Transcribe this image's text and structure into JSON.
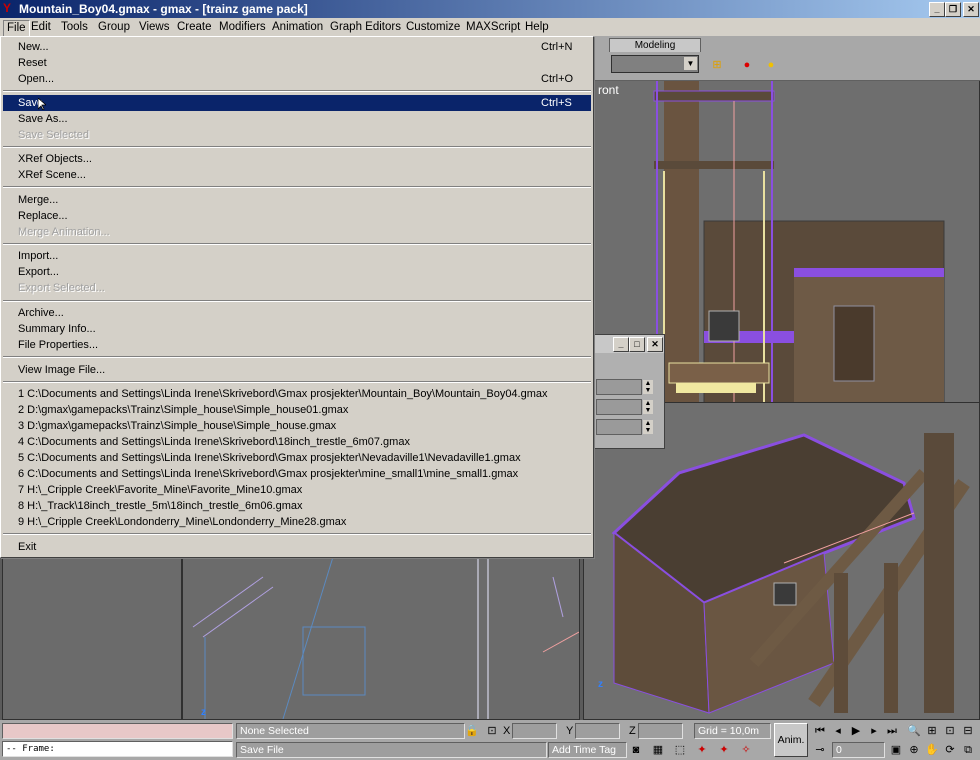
{
  "window": {
    "title": "Mountain_Boy04.gmax - gmax - [trainz game pack]",
    "app_icon": "gmax-logo-icon",
    "controls": [
      "_",
      "❐",
      "✕"
    ]
  },
  "menubar": {
    "items": [
      "File",
      "Edit",
      "Tools",
      "Group",
      "Views",
      "Create",
      "Modifiers",
      "Animation",
      "Graph Editors",
      "Customize",
      "MAXScript",
      "Help"
    ],
    "open_item": "File"
  },
  "file_menu": {
    "items": [
      {
        "label": "New...",
        "shortcut": "Ctrl+N",
        "state": "normal"
      },
      {
        "label": "Reset",
        "shortcut": "",
        "state": "normal"
      },
      {
        "label": "Open...",
        "shortcut": "Ctrl+O",
        "state": "normal"
      },
      {
        "label": "Save",
        "shortcut": "Ctrl+S",
        "state": "highlighted"
      },
      {
        "label": "Save As...",
        "shortcut": "",
        "state": "normal"
      },
      {
        "label": "Save Selected",
        "shortcut": "",
        "state": "disabled"
      },
      {
        "label": "XRef Objects...",
        "shortcut": "",
        "state": "normal"
      },
      {
        "label": "XRef Scene...",
        "shortcut": "",
        "state": "normal"
      },
      {
        "label": "Merge...",
        "shortcut": "",
        "state": "normal"
      },
      {
        "label": "Replace...",
        "shortcut": "",
        "state": "normal"
      },
      {
        "label": "Merge Animation...",
        "shortcut": "",
        "state": "disabled"
      },
      {
        "label": "Import...",
        "shortcut": "",
        "state": "normal"
      },
      {
        "label": "Export...",
        "shortcut": "",
        "state": "normal"
      },
      {
        "label": "Export Selected...",
        "shortcut": "",
        "state": "disabled"
      },
      {
        "label": "Archive...",
        "shortcut": "",
        "state": "normal"
      },
      {
        "label": "Summary Info...",
        "shortcut": "",
        "state": "normal"
      },
      {
        "label": "File Properties...",
        "shortcut": "",
        "state": "normal"
      },
      {
        "label": "View Image File...",
        "shortcut": "",
        "state": "normal"
      },
      {
        "label": "1 C:\\Documents and Settings\\Linda Irene\\Skrivebord\\Gmax prosjekter\\Mountain_Boy\\Mountain_Boy04.gmax",
        "shortcut": "",
        "state": "normal"
      },
      {
        "label": "2 D:\\gmax\\gamepacks\\Trainz\\Simple_house\\Simple_house01.gmax",
        "shortcut": "",
        "state": "normal"
      },
      {
        "label": "3 D:\\gmax\\gamepacks\\Trainz\\Simple_house\\Simple_house.gmax",
        "shortcut": "",
        "state": "normal"
      },
      {
        "label": "4 C:\\Documents and Settings\\Linda Irene\\Skrivebord\\18inch_trestle_6m07.gmax",
        "shortcut": "",
        "state": "normal"
      },
      {
        "label": "5 C:\\Documents and Settings\\Linda Irene\\Skrivebord\\Gmax prosjekter\\Nevadaville1\\Nevadaville1.gmax",
        "shortcut": "",
        "state": "normal"
      },
      {
        "label": "6 C:\\Documents and Settings\\Linda Irene\\Skrivebord\\Gmax prosjekter\\mine_small1\\mine_small1.gmax",
        "shortcut": "",
        "state": "normal"
      },
      {
        "label": "7 H:\\_Cripple Creek\\Favorite_Mine\\Favorite_Mine10.gmax",
        "shortcut": "",
        "state": "normal"
      },
      {
        "label": "8 H:\\_Track\\18inch_trestle_5m\\18inch_trestle_6m06.gmax",
        "shortcut": "",
        "state": "normal"
      },
      {
        "label": "9 H:\\_Cripple Creek\\Londonderry_Mine\\Londonderry_Mine28.gmax",
        "shortcut": "",
        "state": "normal"
      },
      {
        "label": "Exit",
        "shortcut": "",
        "state": "normal"
      }
    ]
  },
  "viewports": {
    "front_label": "ront",
    "tab_label": "Modeling"
  },
  "statusbar": {
    "maxscript_listener": "",
    "maxscript_output": "-- Frame:",
    "selection": "None Selected",
    "prompt": "Save File",
    "x_label": "X",
    "y_label": "Y",
    "z_label": "Z",
    "x_value": "",
    "y_value": "",
    "z_value": "",
    "grid": "Grid = 10,0m",
    "add_time_tag": "Add Time Tag",
    "anim_button": "Anim.",
    "frame_value": "0"
  },
  "colors": {
    "titlebar_start": "#0a246a",
    "titlebar_end": "#a6caf0",
    "menu_highlight": "#0a246a",
    "selection_edge": "#8a4fe0"
  }
}
